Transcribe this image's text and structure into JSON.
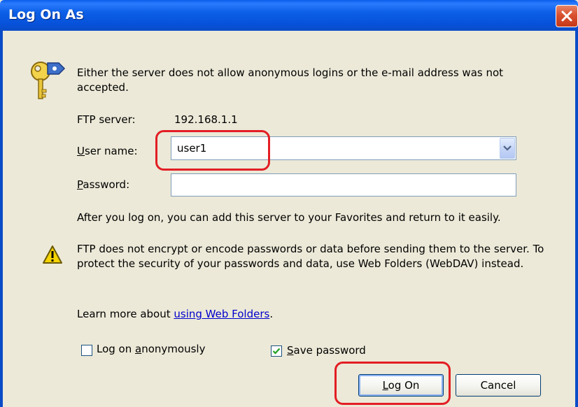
{
  "window": {
    "title": "Log On As"
  },
  "message": "Either the server does not allow anonymous logins or the e-mail address was not accepted.",
  "server": {
    "label": "FTP server:",
    "value": "192.168.1.1"
  },
  "username": {
    "label_pre": "",
    "label_accel": "U",
    "label_post": "ser name:",
    "value": "user1"
  },
  "password": {
    "label_accel": "P",
    "label_post": "assword:",
    "value": ""
  },
  "favorites_note": "After you log on, you can add this server to your Favorites and return to it easily.",
  "warning": "FTP does not encrypt or encode passwords or data before sending them to the server.  To protect the security of your passwords and data, use Web Folders (WebDAV) instead.",
  "learn_more": {
    "prefix": "Learn more about ",
    "link": "using Web Folders",
    "suffix": "."
  },
  "options": {
    "anonymous": {
      "pre": "Log on ",
      "accel": "a",
      "post": "nonymously",
      "checked": false
    },
    "save_password": {
      "accel": "S",
      "post": "ave password",
      "checked": true
    }
  },
  "buttons": {
    "logon": {
      "accel": "L",
      "post": "og On"
    },
    "cancel": "Cancel"
  },
  "colors": {
    "highlight": "#E31E24",
    "titlebar": "#0A5EEA",
    "link": "#0000CC",
    "warning": "#F5D400"
  }
}
